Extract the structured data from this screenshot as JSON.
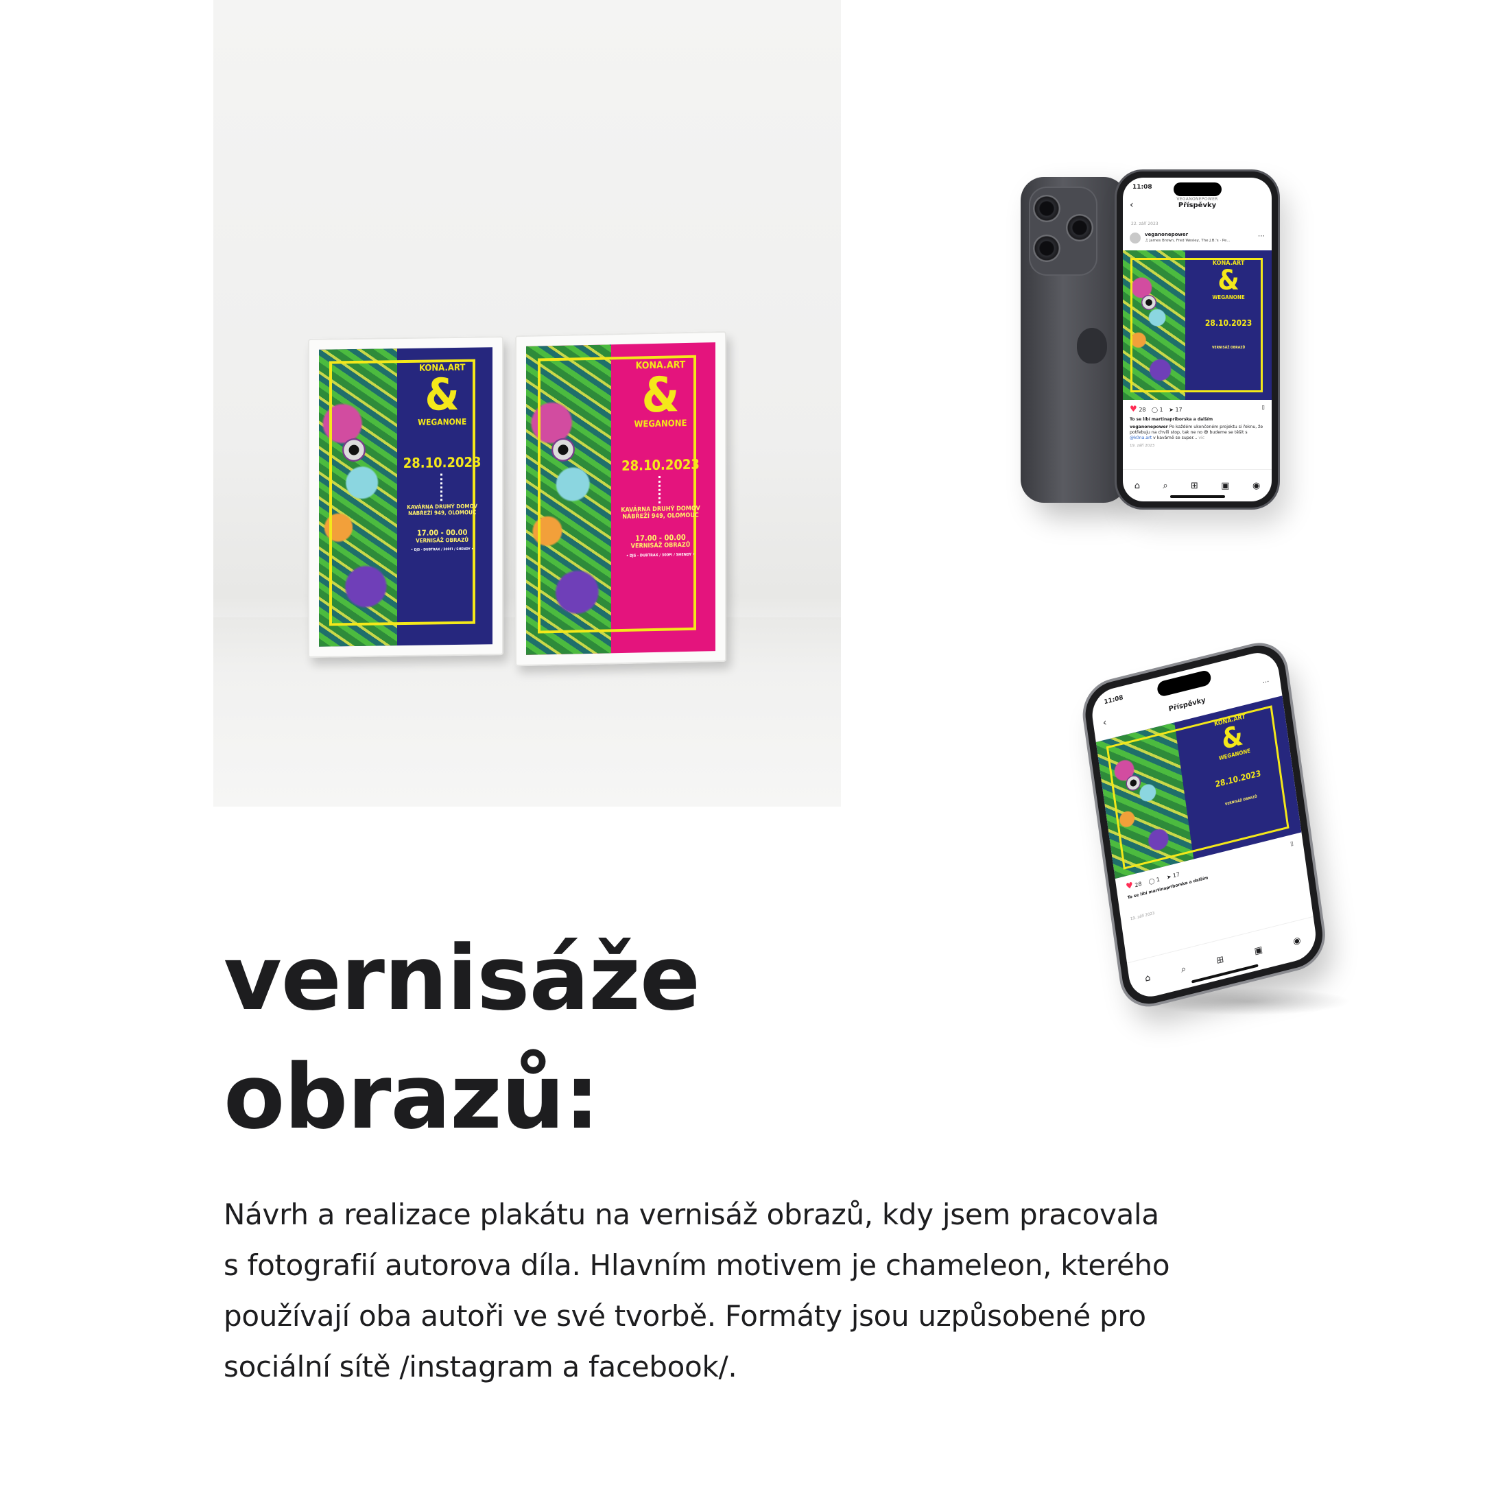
{
  "heading": {
    "line1": "vernisáže",
    "line2": "obrazů:"
  },
  "description": {
    "lines": [
      "Návrh a realizace plakátu na vernisáž obrazů, kdy jsem pracovala",
      "s fotografií autorova díla. Hlavním motivem je chameleon, kterého",
      "používají oba autoři ve své tvorbě. Formáty jsou uzpůsobené pro",
      "sociální sítě /instagram a facebook/."
    ]
  },
  "poster": {
    "title_top": "KONA.ART",
    "ampersand": "&",
    "title_bottom": "WEGANONE",
    "date": "28.10.2023",
    "venue_line1": "KAVÁRNA DRUHÝ DOMOV",
    "venue_line2": "NÁBŘEŽÍ 949, OLOMOUC",
    "time": "17.00 - 00.00",
    "event": "VERNISÁŽ OBRAZŮ",
    "music": "• DJS - DUBTRAX / 300FI / SHENDY •",
    "colors": {
      "blue": "#26277e",
      "pink": "#e4147d",
      "yellow": "#f4e81a"
    }
  },
  "instagram": {
    "status_time": "11:08",
    "account": "VEGANONEPOWER",
    "screen_title": "Příspěvky",
    "post_date": "22. září 2023",
    "username": "veganonepower",
    "song": "♫ James Brown, Fred Wesley, The J.B.'s · Pe...",
    "likes": "28",
    "comments": "1",
    "shares": "17",
    "liked_by": "To se líbí martinapriborska a dalším",
    "caption_user": "veganonepower",
    "caption_text": "Po každém ukončeném projektu si řeknu, že potřebuju na chvíli stop, tak ne no 😅 budeme se těšit s",
    "caption_mention": "@k0na.art",
    "caption_end": "v kavárně se super...",
    "caption_more": "víc",
    "date_small": "19. září 2023"
  },
  "icons": {
    "back": "chevron-left-icon",
    "more": "more-dots-icon",
    "heart": "heart-icon",
    "comment": "comment-icon",
    "share": "share-icon",
    "bookmark": "bookmark-icon",
    "nav": [
      "home-icon",
      "search-icon",
      "create-icon",
      "reels-icon",
      "profile-icon"
    ]
  }
}
